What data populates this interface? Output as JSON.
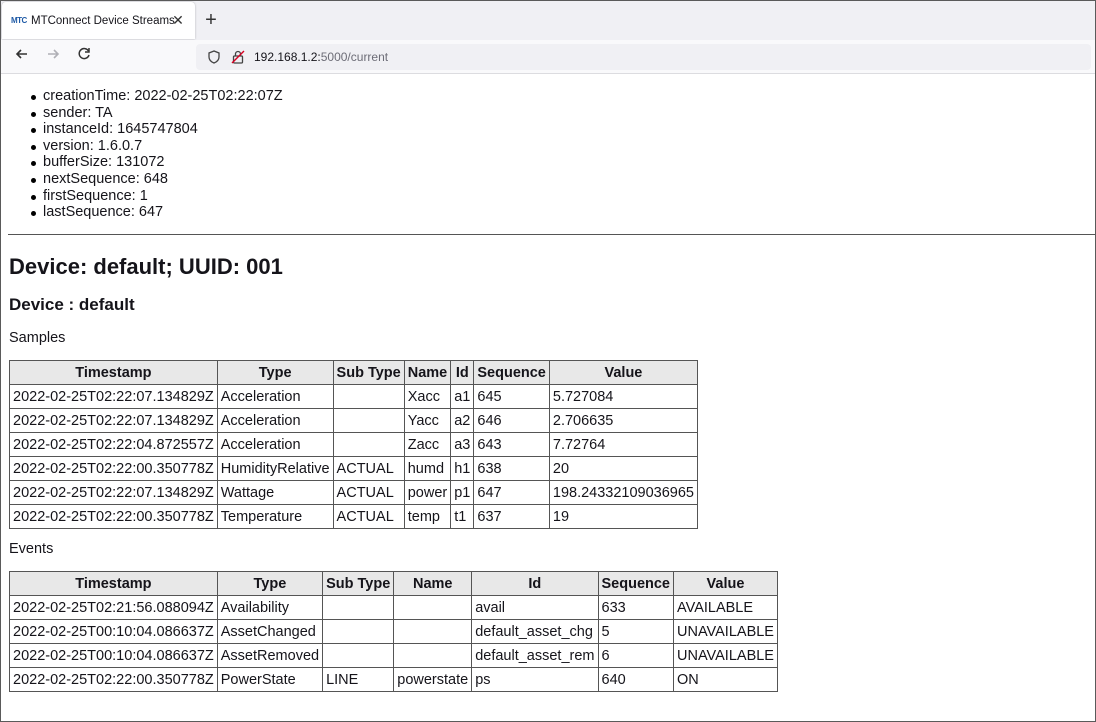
{
  "browser": {
    "tab_title": "MTConnect Device Streams",
    "favicon_text": "MTC",
    "url_host": "192.168.1.2:",
    "url_rest": "5000/current"
  },
  "header": [
    "creationTime: 2022-02-25T02:22:07Z",
    "sender: TA",
    "instanceId: 1645747804",
    "version: 1.6.0.7",
    "bufferSize: 131072",
    "nextSequence: 648",
    "firstSequence: 1",
    "lastSequence: 647"
  ],
  "device_title": "Device: default; UUID: 001",
  "device_subtitle": "Device : default",
  "samples": {
    "label": "Samples",
    "columns": [
      "Timestamp",
      "Type",
      "Sub Type",
      "Name",
      "Id",
      "Sequence",
      "Value"
    ],
    "rows": [
      [
        "2022-02-25T02:22:07.134829Z",
        "Acceleration",
        "",
        "Xacc",
        "a1",
        "645",
        "5.727084"
      ],
      [
        "2022-02-25T02:22:07.134829Z",
        "Acceleration",
        "",
        "Yacc",
        "a2",
        "646",
        "2.706635"
      ],
      [
        "2022-02-25T02:22:04.872557Z",
        "Acceleration",
        "",
        "Zacc",
        "a3",
        "643",
        "7.72764"
      ],
      [
        "2022-02-25T02:22:00.350778Z",
        "HumidityRelative",
        "ACTUAL",
        "humd",
        "h1",
        "638",
        "20"
      ],
      [
        "2022-02-25T02:22:07.134829Z",
        "Wattage",
        "ACTUAL",
        "power",
        "p1",
        "647",
        "198.24332109036965"
      ],
      [
        "2022-02-25T02:22:00.350778Z",
        "Temperature",
        "ACTUAL",
        "temp",
        "t1",
        "637",
        "19"
      ]
    ]
  },
  "events": {
    "label": "Events",
    "columns": [
      "Timestamp",
      "Type",
      "Sub Type",
      "Name",
      "Id",
      "Sequence",
      "Value"
    ],
    "rows": [
      [
        "2022-02-25T02:21:56.088094Z",
        "Availability",
        "",
        "",
        "avail",
        "633",
        "AVAILABLE"
      ],
      [
        "2022-02-25T00:10:04.086637Z",
        "AssetChanged",
        "",
        "",
        "default_asset_chg",
        "5",
        "UNAVAILABLE"
      ],
      [
        "2022-02-25T00:10:04.086637Z",
        "AssetRemoved",
        "",
        "",
        "default_asset_rem",
        "6",
        "UNAVAILABLE"
      ],
      [
        "2022-02-25T02:22:00.350778Z",
        "PowerState",
        "LINE",
        "powerstate",
        "ps",
        "640",
        "ON"
      ]
    ]
  }
}
